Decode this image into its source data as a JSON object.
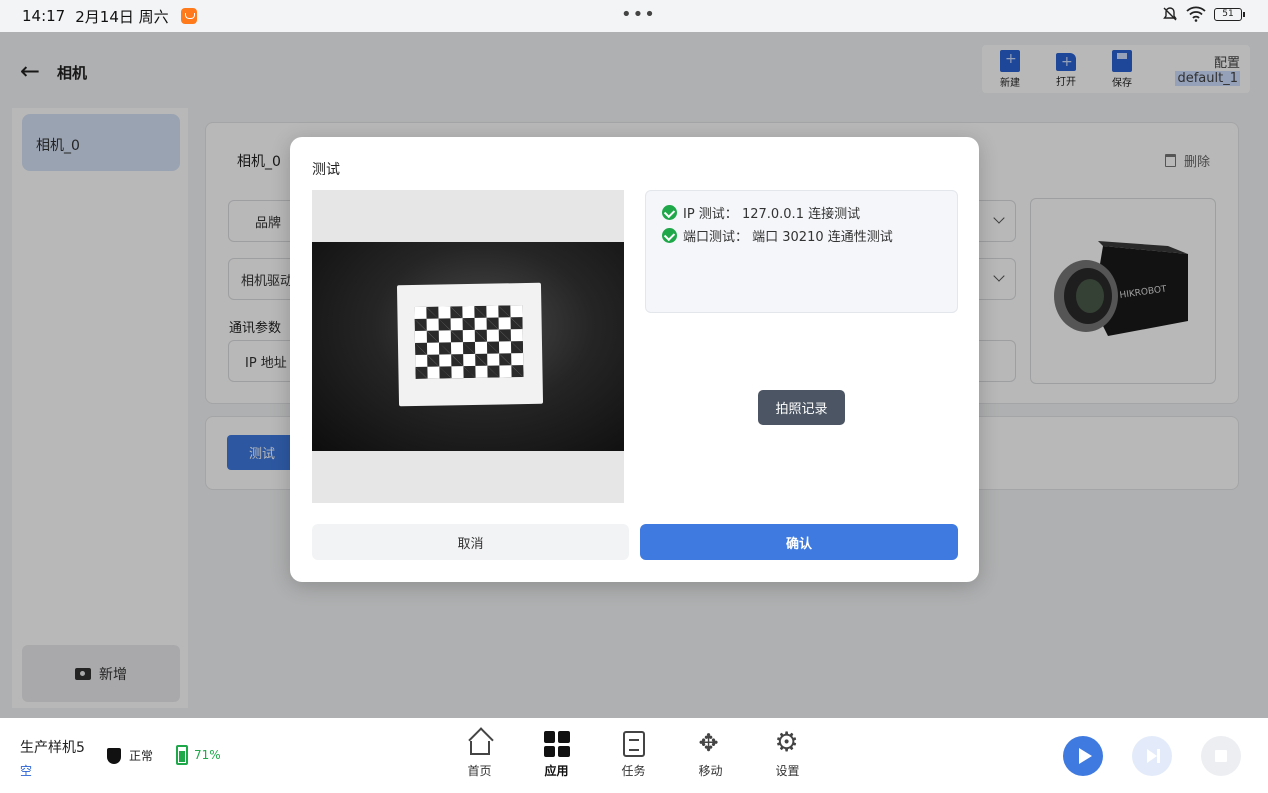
{
  "status_bar": {
    "time": "14:17",
    "date": "2月14日 周六",
    "battery": "51"
  },
  "header": {
    "title": "相机",
    "toolbar": {
      "new_label": "新建",
      "open_label": "打开",
      "save_label": "保存",
      "config_label": "配置",
      "config_value": "default_1"
    }
  },
  "sidebar": {
    "items": [
      {
        "label": "相机_0"
      }
    ],
    "add_label": "新增"
  },
  "main": {
    "camera_name": "相机_0",
    "delete_label": "删除",
    "brand_label": "品牌",
    "driver_label": "相机驱动",
    "comm_section": "通讯参数",
    "ip_label": "IP 地址",
    "test_button": "测试",
    "camera_brand_text": "HIKROBOT"
  },
  "dialog": {
    "title": "测试",
    "log": [
      {
        "text": "IP 测试：  127.0.0.1 连接测试"
      },
      {
        "text": "端口测试：  端口 30210 连通性测试"
      }
    ],
    "photo_log_button": "拍照记录",
    "cancel_button": "取消",
    "confirm_button": "确认"
  },
  "bottom_bar": {
    "machine_name": "生产样机5",
    "machine_sub": "空",
    "status_text": "正常",
    "battery_text": "71%",
    "nav": [
      {
        "label": "首页",
        "icon": "home-icon"
      },
      {
        "label": "应用",
        "icon": "apps-icon",
        "active": true
      },
      {
        "label": "任务",
        "icon": "task-icon"
      },
      {
        "label": "移动",
        "icon": "move-icon"
      },
      {
        "label": "设置",
        "icon": "settings-icon"
      }
    ]
  },
  "colors": {
    "accent": "#3f7ae0",
    "success": "#1fa84a",
    "dark_button": "#4b5563"
  }
}
